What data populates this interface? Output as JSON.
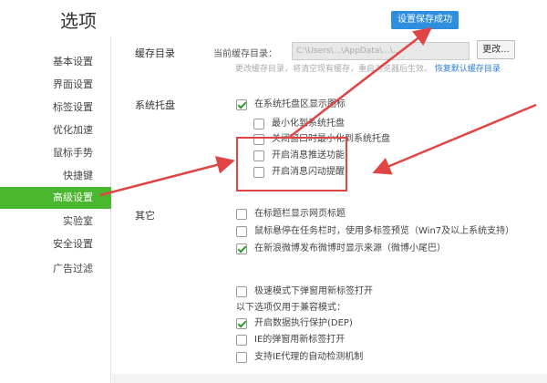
{
  "header": {
    "title": "选项",
    "save_toast": "设置保存成功"
  },
  "sidebar": {
    "items": [
      {
        "label": "基本设置"
      },
      {
        "label": "界面设置"
      },
      {
        "label": "标签设置"
      },
      {
        "label": "优化加速"
      },
      {
        "label": "鼠标手势"
      },
      {
        "label": "快捷键"
      },
      {
        "label": "高级设置",
        "active": true
      },
      {
        "label": "实验室"
      },
      {
        "label": "安全设置"
      },
      {
        "label": "广告过滤"
      }
    ]
  },
  "cache": {
    "section_label": "缓存目录",
    "current_label": "当前缓存目录：",
    "path_value": "C:\\Users\\...\\AppData\\...\\...",
    "change_button": "更改...",
    "hint": "更改缓存目录，将清空现有缓存，重启浏览器后生效。",
    "restore_link": "恢复默认缓存目录"
  },
  "tray": {
    "section_label": "系统托盘",
    "options": [
      {
        "label": "在系统托盘区显示图标",
        "checked": true
      },
      {
        "label": "最小化到系统托盘",
        "checked": false
      },
      {
        "label": "关闭窗口时最小化到系统托盘",
        "checked": false
      },
      {
        "label": "开启消息推送功能",
        "checked": false
      },
      {
        "label": "开启消息闪动提醒",
        "checked": false
      }
    ]
  },
  "other": {
    "section_label": "其它",
    "options": [
      {
        "label": "在标题栏显示网页标题",
        "checked": false
      },
      {
        "label": "鼠标悬停在任务栏时，使用多标签预览（Win7及以上系统支持）",
        "checked": false
      },
      {
        "label": "在新浪微博发布微博时显示来源（微博小尾巴）",
        "checked": true
      },
      {
        "label": "极速模式下弹窗用新标签打开",
        "checked": false
      }
    ],
    "compat_heading": "以下选项仅用于兼容模式：",
    "compat_options": [
      {
        "label": "开启数据执行保护(DEP)",
        "checked": true
      },
      {
        "label": "IE的弹窗用新标签打开",
        "checked": false
      },
      {
        "label": "支持IE代理的自动检测机制",
        "checked": false
      }
    ]
  },
  "colors": {
    "accent_green": "#4ab82e",
    "toast_blue": "#2e8ee0",
    "annotation_red": "#e04545"
  }
}
